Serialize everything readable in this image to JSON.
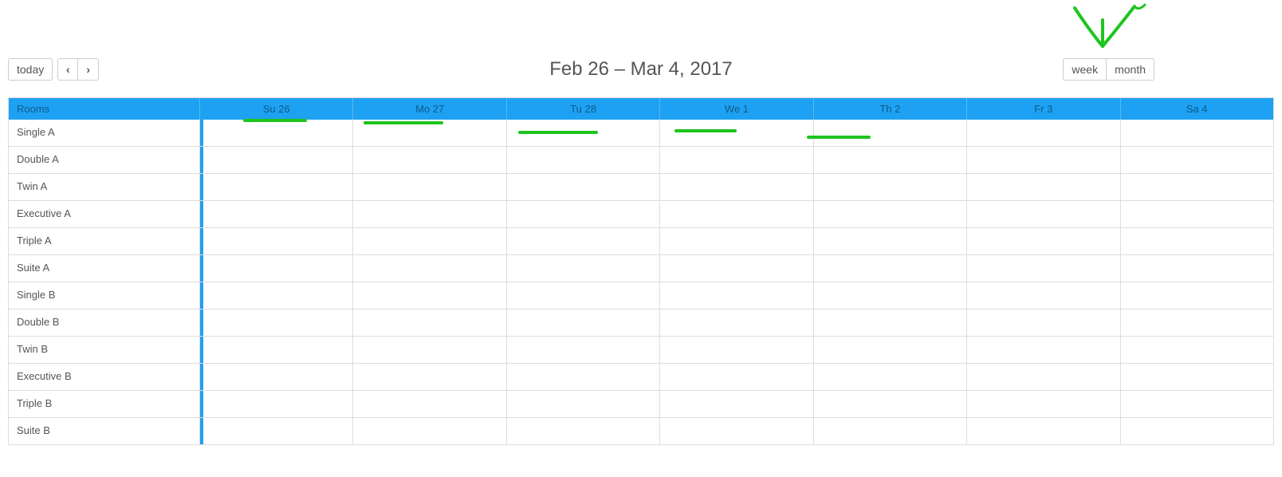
{
  "toolbar": {
    "today_label": "today",
    "prev_icon": "‹",
    "next_icon": "›",
    "title": "Feb 26 – Mar 4, 2017",
    "week_label": "week",
    "month_label": "month"
  },
  "header": {
    "resource_label": "Rooms",
    "days": [
      "Su 26",
      "Mo 27",
      "Tu 28",
      "We 1",
      "Th 2",
      "Fr 3",
      "Sa 4"
    ]
  },
  "rooms": [
    "Single A",
    "Double A",
    "Twin A",
    "Executive A",
    "Triple A",
    "Suite A",
    "Single B",
    "Double B",
    "Twin B",
    "Executive B",
    "Triple B",
    "Suite B"
  ],
  "colors": {
    "header_bg": "#1ea1f2",
    "annotation_green": "#1ec41e"
  }
}
